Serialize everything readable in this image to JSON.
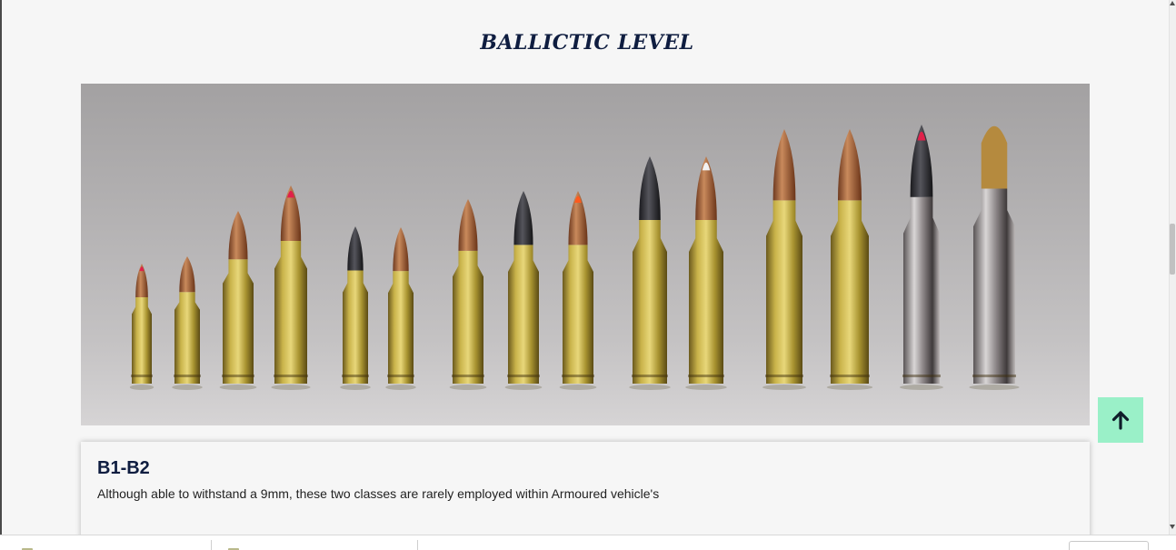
{
  "section": {
    "title": "BALLICTIC LEVEL"
  },
  "hero": {
    "image_alt": "Row of rifle cartridges of increasing size"
  },
  "card": {
    "title": "B1-B2",
    "text": "Although able to withstand a 9mm, these two classes are rarely employed within Armoured vehicle's"
  },
  "scroll_top": {
    "icon": "arrow-up-icon"
  },
  "colors": {
    "title": "#0f1d40",
    "scroll_top_bg": "#9af0c8",
    "page_bg": "#f6f6f6"
  }
}
